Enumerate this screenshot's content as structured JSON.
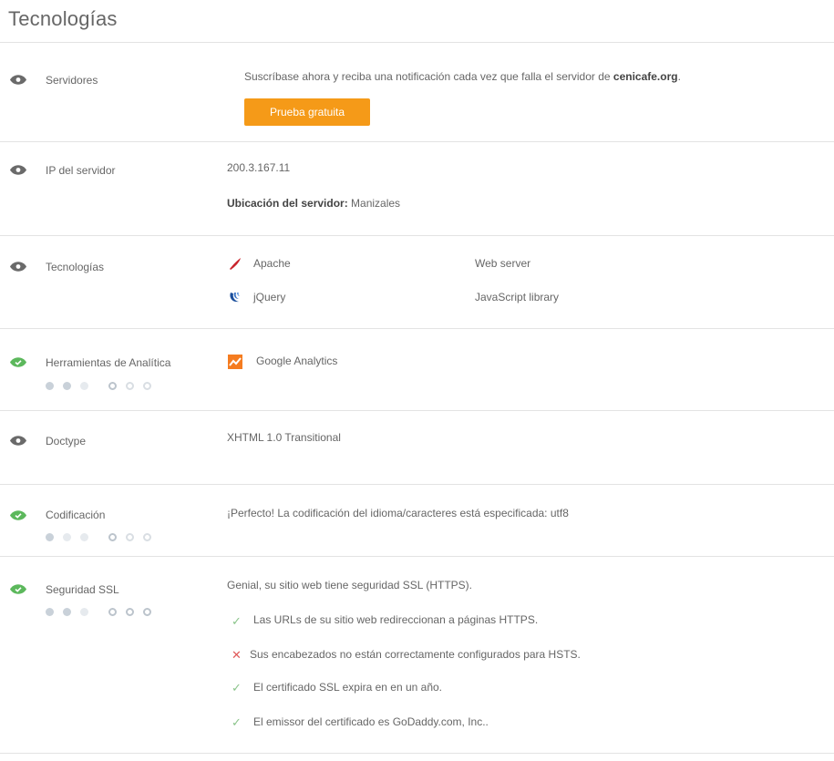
{
  "title": "Tecnologías",
  "servers": {
    "label": "Servidores",
    "message_prefix": "Suscríbase ahora y reciba una notificación cada vez que falla el servidor de ",
    "domain": "cenicafe.org",
    "message_suffix": ".",
    "button": "Prueba gratuita"
  },
  "ip": {
    "label": "IP del servidor",
    "value": "200.3.167.11",
    "location_label": "Ubicación del servidor:",
    "location_value": " Manizales"
  },
  "technologies": {
    "label": "Tecnologías",
    "items": [
      {
        "name": "Apache",
        "category": "Web server",
        "icon": "apache-feather-icon"
      },
      {
        "name": "jQuery",
        "category": "JavaScript library",
        "icon": "jquery-icon"
      }
    ]
  },
  "analytics": {
    "label": "Herramientas de Analítica",
    "tool": "Google Analytics",
    "icon": "google-analytics-icon"
  },
  "doctype": {
    "label": "Doctype",
    "value": "XHTML 1.0 Transitional"
  },
  "encoding": {
    "label": "Codificación",
    "message": "¡Perfecto! La codificación del idioma/caracteres está especificada: utf8"
  },
  "ssl": {
    "label": "Seguridad SSL",
    "summary": "Genial, su sitio web tiene seguridad SSL (HTTPS).",
    "checks": [
      {
        "status": "pass",
        "text": "Las URLs de su sitio web redireccionan a páginas HTTPS."
      },
      {
        "status": "fail",
        "text": "Sus encabezados no están correctamente configurados para HSTS."
      },
      {
        "status": "pass",
        "text": "El certificado SSL expira en en un año."
      },
      {
        "status": "pass",
        "text": "El emissor del certificado es GoDaddy.com, Inc.."
      }
    ]
  },
  "colors": {
    "accent_orange": "#f59a18",
    "status_green": "#5cb85c",
    "status_gray": "#666666"
  }
}
